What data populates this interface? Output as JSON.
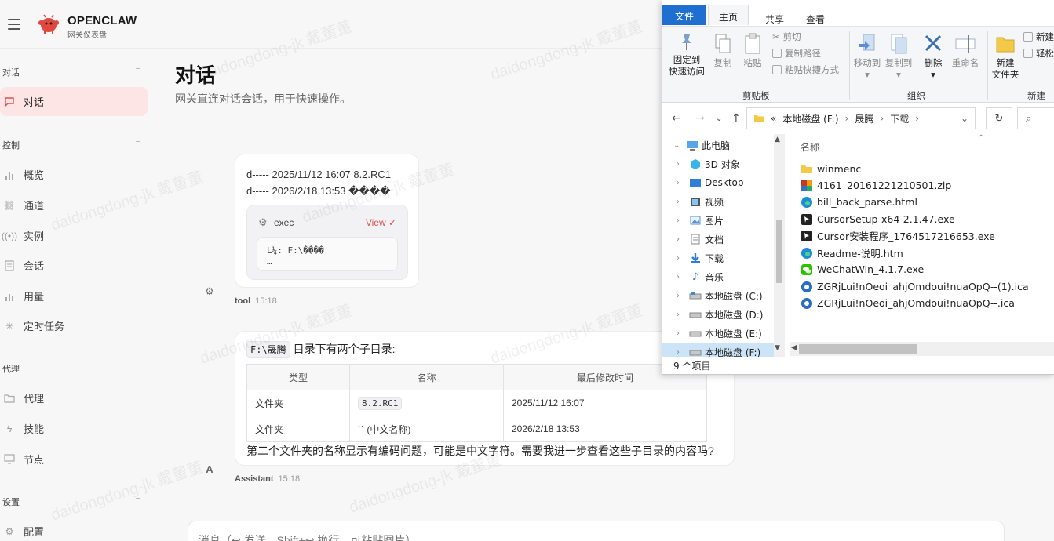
{
  "app": {
    "brand": "OPENCLAW",
    "brand_sub": "网关仪表盘"
  },
  "sidebar": {
    "sections": [
      {
        "label": "对话",
        "items": [
          {
            "label": "对话",
            "icon": "chat-icon",
            "active": true
          }
        ]
      },
      {
        "label": "控制",
        "items": [
          {
            "label": "概览",
            "icon": "bar-chart-icon"
          },
          {
            "label": "通道",
            "icon": "link-icon"
          },
          {
            "label": "实例",
            "icon": "broadcast-icon"
          },
          {
            "label": "会话",
            "icon": "document-icon"
          },
          {
            "label": "用量",
            "icon": "bar-chart-icon"
          },
          {
            "label": "定时任务",
            "icon": "sparkle-icon"
          }
        ]
      },
      {
        "label": "代理",
        "items": [
          {
            "label": "代理",
            "icon": "folder-icon"
          },
          {
            "label": "技能",
            "icon": "bolt-icon"
          },
          {
            "label": "节点",
            "icon": "monitor-icon"
          }
        ]
      },
      {
        "label": "设置",
        "items": [
          {
            "label": "配置",
            "icon": "gear-icon"
          }
        ]
      }
    ],
    "collapse_symbol": "−"
  },
  "main": {
    "title": "对话",
    "subtitle": "网关直连对话会话，用于快速操作。",
    "tool_message": {
      "lines": [
        "d----- 2025/11/12 16:07 8.2.RC1",
        "d----- 2026/2/18 13:53 ����"
      ],
      "exec_label": "exec",
      "view_label": "View ✓",
      "output_line1": "L¼: F:\\����",
      "output_line2": "…",
      "author": "tool",
      "time": "15:18"
    },
    "assistant_message": {
      "path_chip": "F:\\晟腾",
      "intro_text": "目录下有两个子目录:",
      "table_headers": [
        "类型",
        "名称",
        "最后修改时间"
      ],
      "table_rows": [
        {
          "type": "文件夹",
          "name": "8.2.RC1",
          "name_is_code": true,
          "modified": "2025/11/12 16:07"
        },
        {
          "type": "文件夹",
          "name": "`` (中文名称)",
          "name_is_code": false,
          "modified": "2026/2/18 13:53"
        }
      ],
      "footer_text": "第二个文件夹的名称显示有编码问题，可能是中文字符。需要我进一步查看这些子目录的内容吗?",
      "avatar_letter": "A",
      "author": "Assistant",
      "time": "15:18"
    },
    "composer_placeholder": "消息（↩ 发送，Shift+↩ 换行，可粘贴图片）"
  },
  "explorer": {
    "tabs": [
      "文件",
      "主页",
      "共享",
      "查看"
    ],
    "ribbon": {
      "pin_line1": "固定到",
      "pin_line2": "快速访问",
      "copy": "复制",
      "paste": "粘贴",
      "cut": "剪切",
      "copy_path": "复制路径",
      "paste_shortcut": "粘贴快捷方式",
      "group_clipboard": "剪贴板",
      "move_to": "移动到",
      "copy_to": "复制到",
      "delete": "删除",
      "rename": "重命名",
      "group_organize": "组织",
      "new_folder_line1": "新建",
      "new_folder_line2": "文件夹",
      "new_item": "新建",
      "easy_access": "轻松",
      "group_new": "新建"
    },
    "address": {
      "prefix": "«",
      "parts": [
        "本地磁盘 (F:)",
        "晟腾",
        "下载"
      ],
      "separator": "›"
    },
    "tree": [
      {
        "label": "此电脑",
        "icon": "pc-icon",
        "expanded": true,
        "root": true
      },
      {
        "label": "3D 对象",
        "icon": "cube-icon"
      },
      {
        "label": "Desktop",
        "icon": "desktop-icon"
      },
      {
        "label": "视频",
        "icon": "video-icon"
      },
      {
        "label": "图片",
        "icon": "picture-icon"
      },
      {
        "label": "文档",
        "icon": "document-icon"
      },
      {
        "label": "下载",
        "icon": "download-icon"
      },
      {
        "label": "音乐",
        "icon": "music-icon"
      },
      {
        "label": "本地磁盘 (C:)",
        "icon": "drive-icon"
      },
      {
        "label": "本地磁盘 (D:)",
        "icon": "drive-icon"
      },
      {
        "label": "本地磁盘 (E:)",
        "icon": "drive-icon"
      },
      {
        "label": "本地磁盘 (F:)",
        "icon": "drive-icon",
        "selected": true
      }
    ],
    "column_name": "名称",
    "files": [
      {
        "name": "winmenc",
        "icon": "folder-icon",
        "color": "#e8b647"
      },
      {
        "name": "4161_20161221210501.zip",
        "icon": "archive-icon",
        "color": "#b03a2e"
      },
      {
        "name": "bill_back_parse.html",
        "icon": "edge-icon",
        "color": "#1b8cd6"
      },
      {
        "name": "CursorSetup-x64-2.1.47.exe",
        "icon": "cursor-app-icon",
        "color": "#222222"
      },
      {
        "name": "Cursor安装程序_1764517216653.exe",
        "icon": "cursor-app-icon",
        "color": "#222222"
      },
      {
        "name": "Readme-说明.htm",
        "icon": "edge-icon",
        "color": "#1b8cd6"
      },
      {
        "name": "WeChatWin_4.1.7.exe",
        "icon": "wechat-icon",
        "color": "#2dc100"
      },
      {
        "name": "ZGRjLui!nOeoi_ahjOmdoui!nuaOpQ--(1).ica",
        "icon": "ica-icon",
        "color": "#2b6cc4"
      },
      {
        "name": "ZGRjLui!nOeoi_ahjOmdoui!nuaOpQ--.ica",
        "icon": "ica-icon",
        "color": "#2b6cc4"
      }
    ],
    "status": "9 个项目"
  },
  "watermark_text": "daidongdong-jk 戴董董",
  "colors": {
    "accent": "#e0504f",
    "active_bg": "#fde5e5",
    "explorer_blue": "#1f6fd0"
  }
}
